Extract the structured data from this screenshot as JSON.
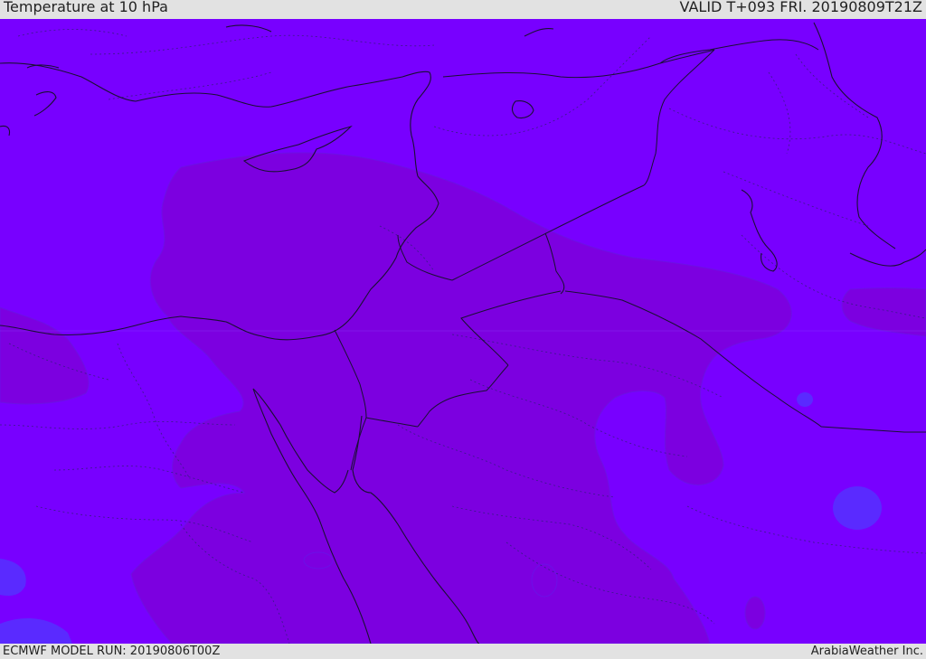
{
  "header": {
    "title": "Temperature at 10 hPa",
    "valid": "VALID T+093 FRI. 20190809T21Z"
  },
  "footer": {
    "model_run": "ECMWF MODEL RUN: 20190806T00Z",
    "credit": "ArabiaWeather Inc."
  },
  "map": {
    "colors": {
      "background_field": "#7800ff",
      "warm_field": "#7c00e0",
      "cold_spot": "#5a2aff",
      "coastline": "#1a1033",
      "border": "#1a1033"
    }
  }
}
